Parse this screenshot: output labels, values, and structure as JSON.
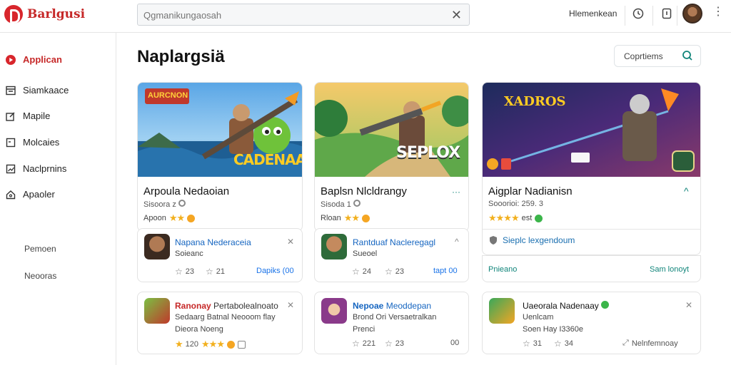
{
  "header": {
    "logo_text": "Barlgusi",
    "search_placeholder": "Qgmanikungaosah",
    "link": "Hlemenkean"
  },
  "sidebar": {
    "items": [
      {
        "label": "Applican",
        "icon": "play-circle-icon",
        "active": true
      },
      {
        "label": "Siamkaace",
        "icon": "window-icon"
      },
      {
        "label": "Mapile",
        "icon": "edit-icon"
      },
      {
        "label": "Molcaies",
        "icon": "square-icon"
      },
      {
        "label": "Naclprnins",
        "icon": "chart-icon"
      },
      {
        "label": "Apaoler",
        "icon": "home-icon"
      }
    ],
    "sub_items": [
      "Pemoen",
      "Neooras"
    ]
  },
  "main": {
    "title": "Naplargsiä",
    "filter_label": "Coprtiems",
    "cards": [
      {
        "banner_text": "CADENAAI",
        "banner_badge": "AURCNON",
        "title": "Arpoula Nedaoian",
        "sub": "Sisoora z",
        "rate_label": "Apoon"
      },
      {
        "banner_text": "SEPLOX",
        "title": "Baplsn Nlcldrangy",
        "sub": "Sisoda 1",
        "rate_label": "Rloan"
      },
      {
        "banner_badge": "XADROS",
        "title": "Aigplar Nadianisn",
        "sub": "Sooorioi: 259. 3",
        "rate_label": "est"
      }
    ],
    "sub_cards_row1": [
      {
        "title": "Napana Nederaceia",
        "line": "Soieanc",
        "stat1": "23",
        "stat2": "21",
        "link": "Dapiks (00"
      },
      {
        "title": "Rantduaf Nacleregagl",
        "line": "Sueoel",
        "stat1": "24",
        "stat2": "23",
        "link": "tapt 00"
      },
      {
        "tag": "Sieplc lexgendoum"
      }
    ],
    "bar3": {
      "left": "Pnieano",
      "right": "Sam lonoyt"
    },
    "sub_cards_row2": [
      {
        "title_bold": "Ranonay",
        "title": "Pertabolealnoato",
        "line1": "Sedaarg Batnal Neooom flay",
        "line2": "Dieora Noeng",
        "stat1": "120"
      },
      {
        "title_bold": "Nepoae",
        "title": "Meoddepan",
        "line1": "Brond Ori Versaetralkan",
        "line2": "Prenci",
        "stat1": "221",
        "stat2": "23",
        "stat3": "00"
      },
      {
        "title": "Uaeorala Nadenaay",
        "line1": "Uenlcam",
        "line2": "Soen Hay I3360e",
        "stat1": "31",
        "stat2": "34",
        "link": "Nelnfemnoay"
      }
    ]
  }
}
